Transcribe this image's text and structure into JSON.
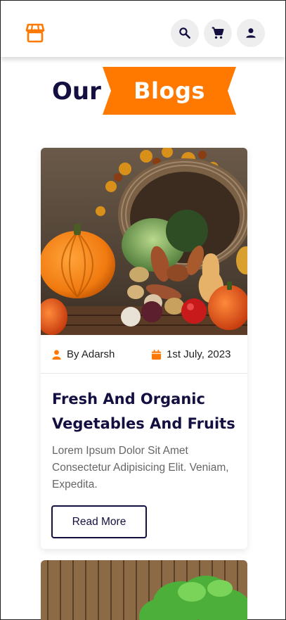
{
  "header": {
    "logo_icon": "store-icon",
    "actions": [
      {
        "name": "search",
        "icon": "search-icon"
      },
      {
        "name": "cart",
        "icon": "cart-icon"
      },
      {
        "name": "account",
        "icon": "user-icon"
      }
    ]
  },
  "heading": {
    "word1": "Our",
    "word2": "Blogs"
  },
  "posts": [
    {
      "author": "By Adarsh",
      "date": "1st July, 2023",
      "title": "Fresh And Organic Vegetables And Fruits",
      "excerpt": "Lorem Ipsum Dolor Sit Amet Consectetur Adipisicing Elit. Veniam, Expedita.",
      "button": "Read More"
    }
  ],
  "colors": {
    "accent": "#ff7800",
    "dark": "#130f40",
    "muted": "#666666",
    "icon_bg": "#eeeeee"
  }
}
